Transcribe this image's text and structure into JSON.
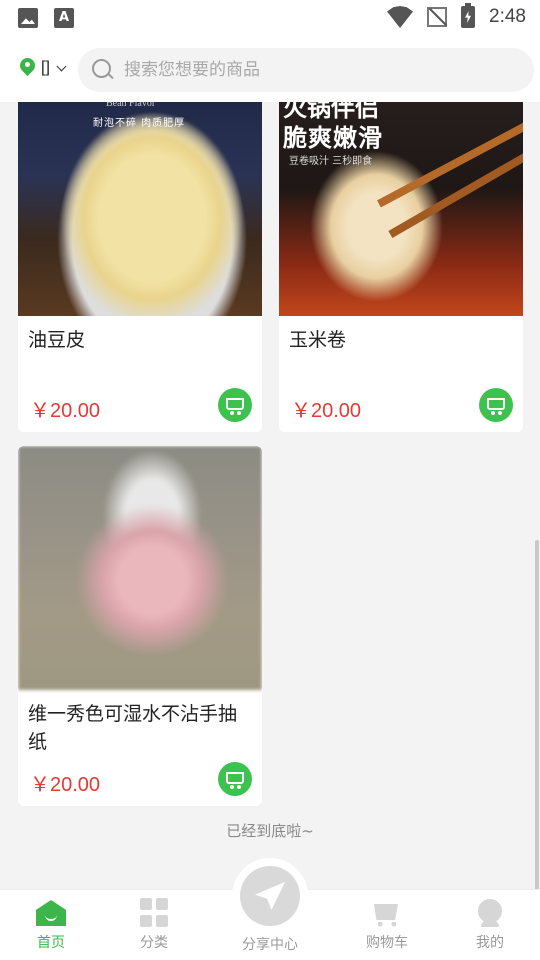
{
  "status_bar": {
    "time": "2:48",
    "notif_icons": [
      "gallery-icon",
      "font-icon"
    ],
    "font_glyph": "A"
  },
  "header": {
    "location_label": "[]",
    "search_placeholder": "搜索您想要的商品"
  },
  "products": [
    {
      "name": "油豆皮",
      "price": "￥20.00",
      "image_text": [
        "Bean Flavor",
        "耐泡不碎 肉质肥厚"
      ]
    },
    {
      "name": "玉米卷",
      "price": "￥20.00",
      "image_text": [
        "火锅伴侣",
        "脆爽嫩滑",
        "豆卷吸汁 三秒即食"
      ]
    },
    {
      "name": "维一秀色可湿水不沾手抽纸",
      "price": "￥20.00"
    }
  ],
  "list_end_text": "已经到底啦~",
  "tabbar": {
    "items": [
      {
        "label": "首页",
        "icon": "home-icon",
        "active": true
      },
      {
        "label": "分类",
        "icon": "category-icon",
        "active": false
      },
      {
        "label": "分享中心",
        "icon": "send-icon",
        "active": false
      },
      {
        "label": "购物车",
        "icon": "cart-icon",
        "active": false
      },
      {
        "label": "我的",
        "icon": "user-icon",
        "active": false
      }
    ]
  },
  "colors": {
    "accent": "#3cb54a",
    "price": "#e53935",
    "background": "#f3f3f3"
  }
}
